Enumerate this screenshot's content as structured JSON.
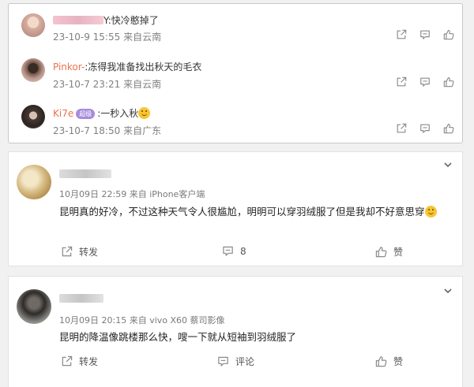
{
  "repost_panel": {
    "comments": [
      {
        "username_blurred": true,
        "text": "Y:快冷憨掉了",
        "timestamp": "23-10-9 15:55",
        "source": "来自云南"
      },
      {
        "username": "Pinkor-",
        "text": ":冻得我准备找出秋天的毛衣",
        "timestamp": "23-10-7 23:21",
        "source": "来自云南"
      },
      {
        "username": "Ki7e",
        "badge": "超级",
        "text": ":一秒入秋",
        "timestamp": "23-10-7 18:50",
        "source": "来自广东"
      }
    ],
    "action_icons": [
      "share-icon",
      "comment-icon",
      "like-icon"
    ]
  },
  "posts": [
    {
      "date": "10月09日 22:59",
      "device": "来自 iPhone客户端",
      "text": "昆明真的好冷，不过这种天气令人很尴尬，明明可以穿羽绒服了但是我却不好意思穿",
      "repost_label": "转发",
      "comment_label": "8",
      "like_label": "赞"
    },
    {
      "date": "10月09日 20:15",
      "device": "来自 vivo X60 蔡司影像",
      "text": "昆明的降温像跳楼那么快，嗖一下就从短袖到羽绒服了",
      "repost_label": "转发",
      "comment_label": "评论",
      "like_label": "赞"
    }
  ]
}
